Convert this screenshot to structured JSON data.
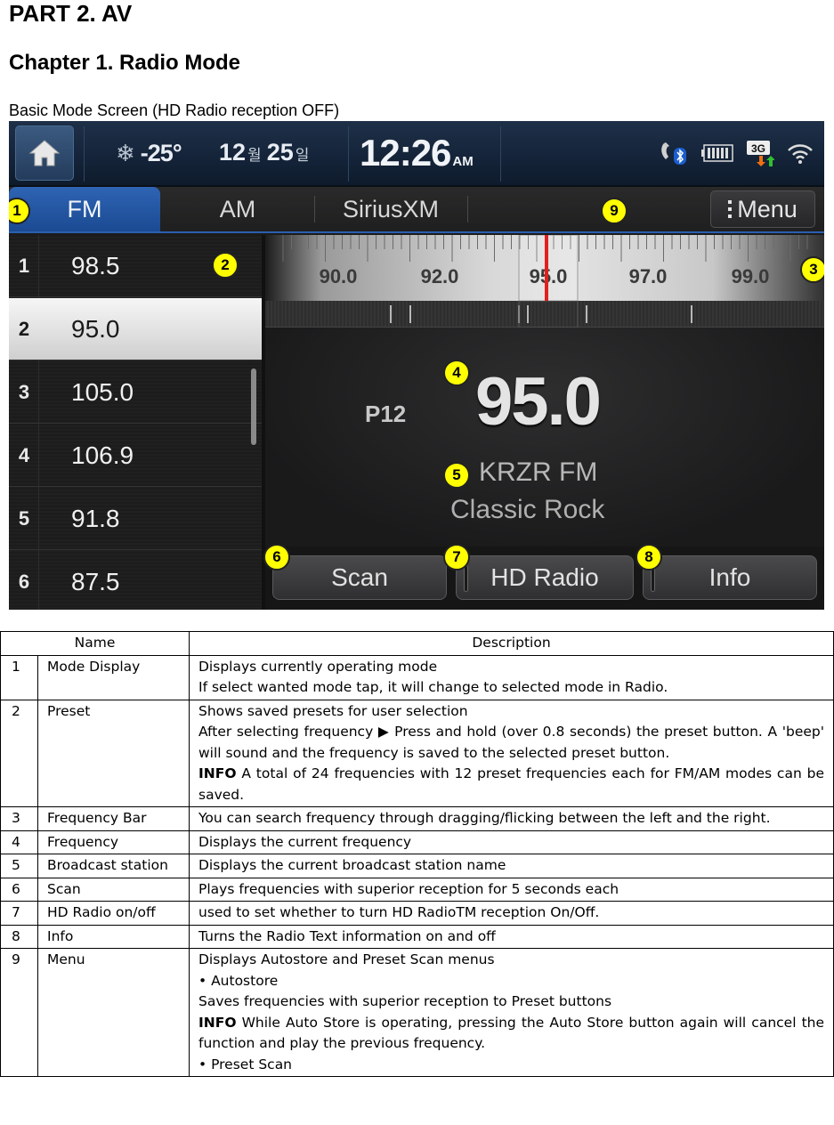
{
  "document": {
    "part_title": "PART 2. AV",
    "chapter_title": "Chapter 1. Radio Mode",
    "section_title": "Basic Mode Screen (HD Radio reception OFF)"
  },
  "screen": {
    "status_bar": {
      "home_icon": "home-icon",
      "weather_icon": "snowflake-icon",
      "temperature": "-25°",
      "date_month": "12",
      "date_month_unit": "월",
      "date_day": "25",
      "date_day_unit": "일",
      "time": "12:26",
      "ampm": "AM",
      "icons": [
        "bluetooth-phone-icon",
        "battery-icon",
        "3g-data-icon",
        "wifi-icon"
      ],
      "network_label": "3G"
    },
    "tabs": [
      {
        "label": "FM",
        "active": true
      },
      {
        "label": "AM",
        "active": false
      },
      {
        "label": "SiriusXM",
        "active": false
      }
    ],
    "menu_label": "Menu",
    "presets": [
      {
        "num": "1",
        "freq": "98.5",
        "selected": false
      },
      {
        "num": "2",
        "freq": "95.0",
        "selected": true
      },
      {
        "num": "3",
        "freq": "105.0",
        "selected": false
      },
      {
        "num": "4",
        "freq": "106.9",
        "selected": false
      },
      {
        "num": "5",
        "freq": "91.8",
        "selected": false
      },
      {
        "num": "6",
        "freq": "87.5",
        "selected": false
      }
    ],
    "frequency_bar": {
      "labels": [
        "90.0",
        "92.0",
        "95.0",
        "97.0",
        "99.0"
      ],
      "current": 95.0,
      "needle_color": "#e02020"
    },
    "now_playing": {
      "preset_tag": "P12",
      "frequency": "95.0",
      "station": "KRZR FM",
      "genre": "Classic Rock"
    },
    "buttons": {
      "scan": "Scan",
      "hd_radio": "HD Radio",
      "info": "Info"
    },
    "callouts": [
      "1",
      "2",
      "3",
      "4",
      "5",
      "6",
      "7",
      "8",
      "9"
    ],
    "callout_color": "#ffff00"
  },
  "table": {
    "headers": {
      "name": "Name",
      "description": "Description"
    },
    "rows": [
      {
        "num": "1",
        "name": "Mode Display",
        "lines": [
          "Displays currently operating mode",
          "If select wanted mode tap, it will change to selected mode in Radio."
        ]
      },
      {
        "num": "2",
        "name": "Preset",
        "lines": [
          "Shows saved presets for user selection",
          "After selecting frequency ▶ Press and hold (over 0.8 seconds) the preset button. A 'beep' will sound and the frequency is saved to the selected preset button."
        ],
        "info": "A total of 24 frequencies with 12 preset frequencies each for FM/AM modes can be saved."
      },
      {
        "num": "3",
        "name": "Frequency Bar",
        "lines": [
          "You can search frequency through dragging/flicking between the left and the right."
        ]
      },
      {
        "num": "4",
        "name": "Frequency",
        "lines": [
          "Displays the current frequency"
        ]
      },
      {
        "num": "5",
        "name": "Broadcast station",
        "lines": [
          "Displays the current broadcast station name"
        ]
      },
      {
        "num": "6",
        "name": "Scan",
        "lines": [
          "Plays frequencies with superior reception for 5 seconds each"
        ]
      },
      {
        "num": "7",
        "name": "HD Radio on/off",
        "lines": [
          "used to set whether to turn HD RadioTM reception On/Off."
        ]
      },
      {
        "num": "8",
        "name": "Info",
        "lines": [
          "Turns the Radio Text information on and off"
        ]
      },
      {
        "num": "9",
        "name": "Menu",
        "lines": [
          "Displays Autostore and Preset Scan menus",
          "• Autostore",
          "Saves frequencies with superior reception to Preset buttons"
        ],
        "info": "While Auto Store is operating, pressing the Auto Store button again will cancel the function and play the previous frequency.",
        "after_info": [
          "• Preset Scan"
        ]
      }
    ],
    "info_label": "INFO"
  }
}
